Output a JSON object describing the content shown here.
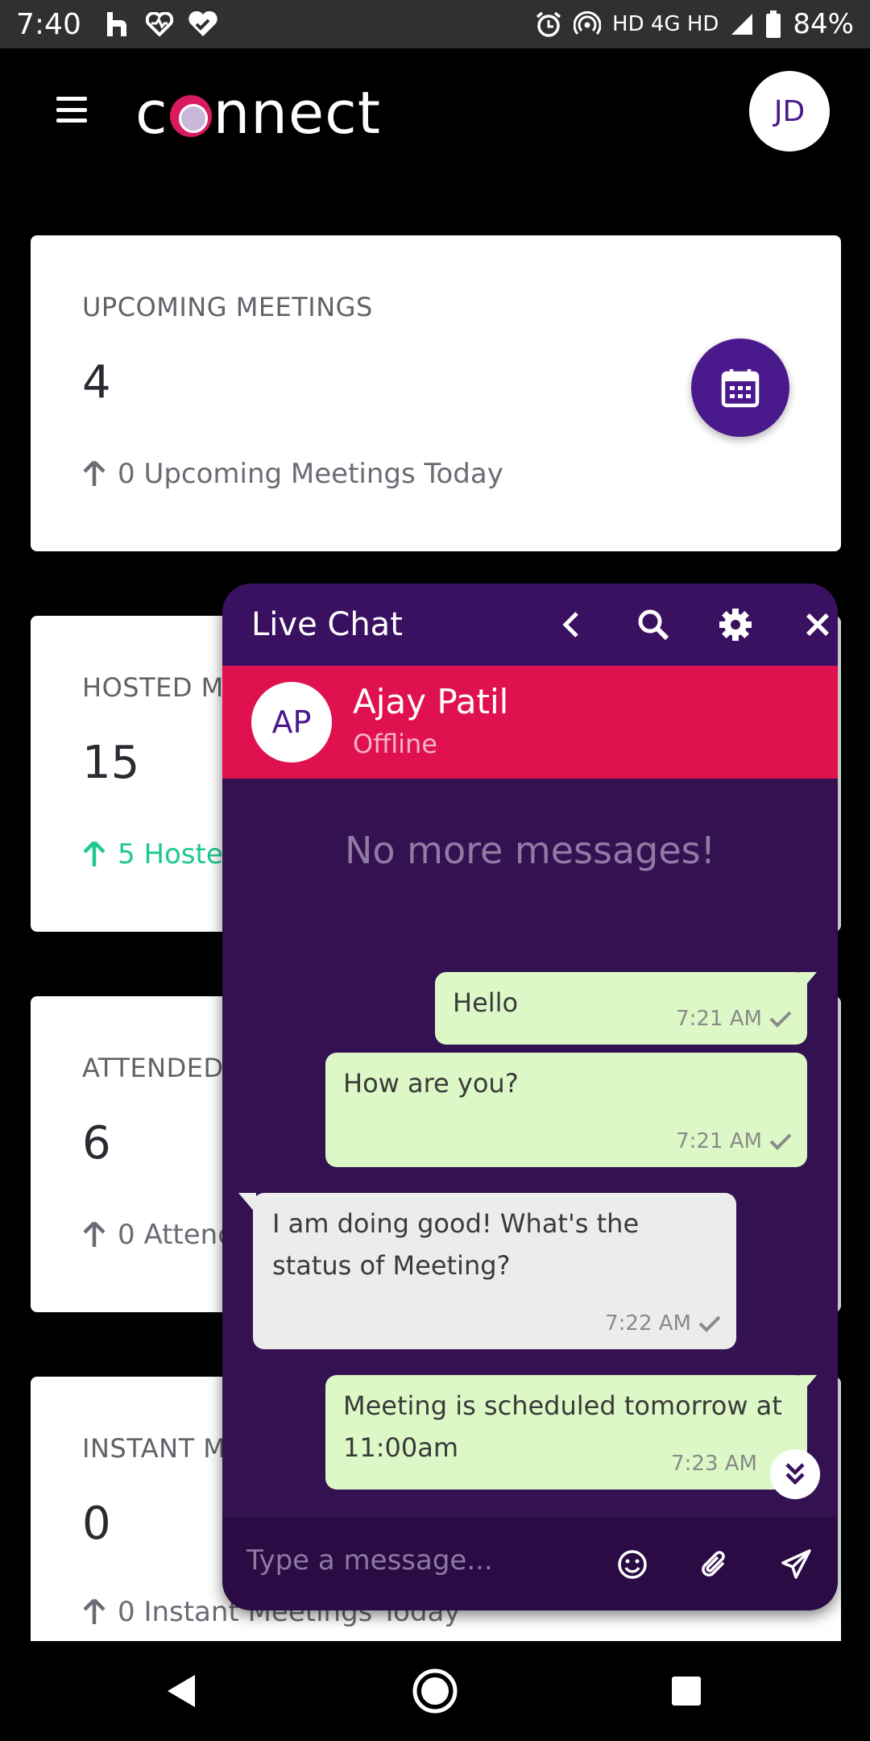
{
  "status_bar": {
    "time": "7:40",
    "network_labels": "HD 4G HD",
    "battery": "84%"
  },
  "app": {
    "logo_text_c": "c",
    "logo_text_rest": "nnect",
    "user_initials": "JD"
  },
  "cards": [
    {
      "title": "UPCOMING MEETINGS",
      "count": "4",
      "sub": "0 Upcoming Meetings Today"
    },
    {
      "title": "HOSTED M",
      "count": "15",
      "sub": "5 Hoste"
    },
    {
      "title": "ATTENDED",
      "count": "6",
      "sub": "0 Attenc"
    },
    {
      "title": "INSTANT M",
      "count": "0",
      "sub": "0 Instant Meetings Today"
    }
  ],
  "chat": {
    "title": "Live Chat",
    "contact": {
      "initials": "AP",
      "name": "Ajay Patil",
      "status": "Offline"
    },
    "no_more": "No more messages!",
    "messages": [
      {
        "dir": "out",
        "text": "Hello",
        "time": "7:21 AM"
      },
      {
        "dir": "out",
        "text": "How are you?",
        "time": "7:21 AM"
      },
      {
        "dir": "in",
        "line1": "I am doing good! What's the",
        "line2": "status of Meeting?",
        "time": "7:22 AM"
      },
      {
        "dir": "out",
        "line1": "Meeting is scheduled tomorrow at",
        "line2": "11:00am",
        "time": "7:23 AM"
      }
    ],
    "input_placeholder": "Type a message..."
  },
  "colors": {
    "brand_purple": "#4a1a8c",
    "chat_bg": "#341252",
    "contact_bar": "#e0114f",
    "bubble_out": "#dcf8c6",
    "bubble_in": "#ececec",
    "positive": "#1dc98e"
  },
  "icons": [
    "menu-icon",
    "calendar-icon",
    "arrow-up-icon",
    "back-icon",
    "search-icon",
    "gear-icon",
    "close-icon",
    "check-icon",
    "double-chevron-down-icon",
    "emoji-icon",
    "attach-icon",
    "send-icon",
    "nav-back-icon",
    "nav-home-icon",
    "nav-recents-icon"
  ]
}
